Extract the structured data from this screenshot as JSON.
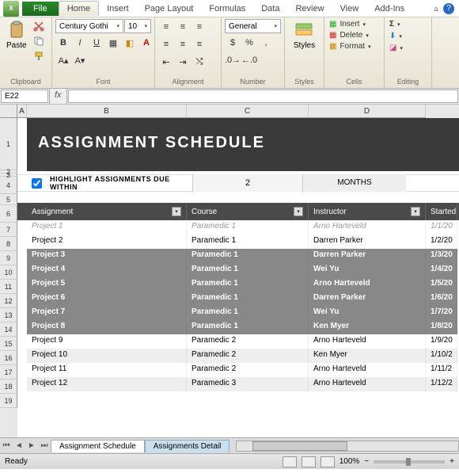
{
  "tabs": {
    "file": "File",
    "home": "Home",
    "insert": "Insert",
    "pageLayout": "Page Layout",
    "formulas": "Formulas",
    "data": "Data",
    "review": "Review",
    "view": "View",
    "addins": "Add-Ins"
  },
  "ribbon": {
    "clipboard": {
      "label": "Clipboard",
      "paste": "Paste"
    },
    "font": {
      "label": "Font",
      "name": "Century Gothi",
      "size": "10"
    },
    "alignment": {
      "label": "Alignment"
    },
    "number": {
      "label": "Number",
      "format": "General"
    },
    "styles": {
      "label": "Styles",
      "cond": "",
      "stylesBtn": "Styles"
    },
    "cells": {
      "label": "Cells",
      "insert": "Insert",
      "delete": "Delete",
      "format": "Format"
    },
    "editing": {
      "label": "Editing"
    }
  },
  "namebox": "E22",
  "fx": "fx",
  "colHeaders": [
    "A",
    "B",
    "C",
    "D"
  ],
  "rowHeaders": [
    "1",
    "2",
    "3",
    "4",
    "5",
    "6",
    "7",
    "8",
    "9",
    "10",
    "11",
    "12",
    "13",
    "14",
    "15",
    "16",
    "17",
    "18",
    "19"
  ],
  "banner": "ASSIGNMENT SCHEDULE",
  "highlight": {
    "label": "HIGHLIGHT ASSIGNMENTS DUE WITHIN",
    "value": "2",
    "unit": "MONTHS"
  },
  "table": {
    "headers": [
      "Assignment",
      "Course",
      "Instructor",
      "Started"
    ],
    "rows": [
      {
        "style": "strike",
        "cells": [
          "Project 1",
          "Paramedic 1",
          "Arno Harteveld",
          "1/1/20"
        ]
      },
      {
        "style": "norm",
        "cells": [
          "Project 2",
          "Paramedic 1",
          "Darren Parker",
          "1/2/20"
        ]
      },
      {
        "style": "hl",
        "cells": [
          "Project 3",
          "Paramedic 1",
          "Darren Parker",
          "1/3/20"
        ]
      },
      {
        "style": "hl",
        "cells": [
          "Project 4",
          "Paramedic 1",
          "Wei Yu",
          "1/4/20"
        ]
      },
      {
        "style": "hl",
        "cells": [
          "Project 5",
          "Paramedic 1",
          "Arno Harteveld",
          "1/5/20"
        ]
      },
      {
        "style": "hl",
        "cells": [
          "Project 6",
          "Paramedic 1",
          "Darren Parker",
          "1/6/20"
        ]
      },
      {
        "style": "hl",
        "cells": [
          "Project 7",
          "Paramedic 1",
          "Wei Yu",
          "1/7/20"
        ]
      },
      {
        "style": "hl",
        "cells": [
          "Project 8",
          "Paramedic 1",
          "Ken Myer",
          "1/8/20"
        ]
      },
      {
        "style": "norm",
        "cells": [
          "Project 9",
          "Paramedic 2",
          "Arno Harteveld",
          "1/9/20"
        ]
      },
      {
        "style": "alt",
        "cells": [
          "Project 10",
          "Paramedic 2",
          "Ken Myer",
          "1/10/2"
        ]
      },
      {
        "style": "norm",
        "cells": [
          "Project 11",
          "Paramedic 2",
          "Arno Harteveld",
          "1/11/2"
        ]
      },
      {
        "style": "alt",
        "cells": [
          "Project 12",
          "Paramedic 3",
          "Arno Harteveld",
          "1/12/2"
        ]
      }
    ]
  },
  "sheetTabs": {
    "active": "Assignment Schedule",
    "inactive": "Assignments Detail"
  },
  "status": {
    "ready": "Ready",
    "zoom": "100%"
  }
}
